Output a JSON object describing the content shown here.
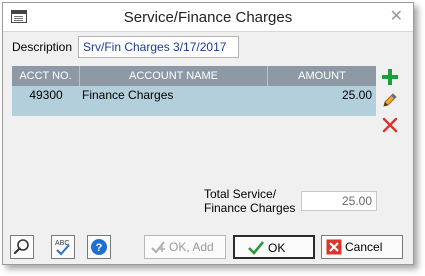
{
  "window": {
    "title": "Service/Finance Charges",
    "close_glyph": "✕"
  },
  "description": {
    "label": "Description",
    "value": "Srv/Fin Charges 3/17/2017"
  },
  "grid": {
    "columns": [
      "ACCT NO.",
      "ACCOUNT NAME",
      "AMOUNT"
    ],
    "rows": [
      {
        "acct_no": "49300",
        "account_name": "Finance Charges",
        "amount": "25.00"
      }
    ]
  },
  "side_actions": [
    "add-icon",
    "edit-pencil-icon",
    "delete-x-icon"
  ],
  "total": {
    "label_line1": "Total Service/",
    "label_line2": "Finance Charges",
    "value": "25.00"
  },
  "buttons": {
    "ok_add": "OK, Add",
    "ok": "OK",
    "cancel": "Cancel"
  },
  "colors": {
    "header": "#8d9aa5",
    "selected_row": "#b3cfdc",
    "add_green": "#1e9e3a",
    "cancel_red": "#d9352b"
  }
}
